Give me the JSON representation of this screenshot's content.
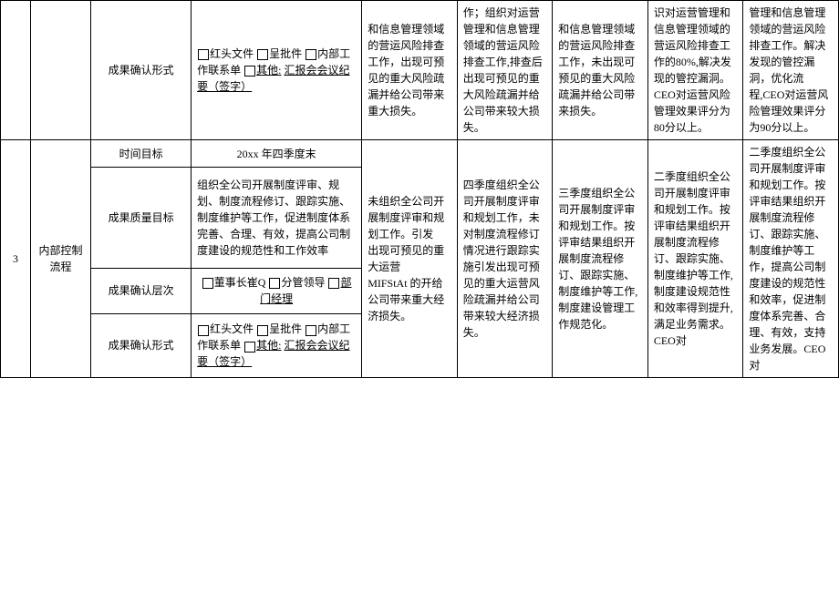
{
  "row1": {
    "label": "成果确认形式",
    "option1_pre": "红头文件",
    "option2_pre": "呈批件",
    "option3_pre": "内部工作联系单",
    "option4_pre": "其他:",
    "other_text": "汇报会会议纪要（签字）",
    "c5": "和信息管理领域的营运风险排查工作，出现可预见的重大风险疏漏并给公司带来重大损失。",
    "c6": "作；组织对运营管理和信息管理领域的营运风险排查工作,排查后出现可预见的重大风险疏漏并给公司带来较大损失。",
    "c7": "和信息管理领域的营运风险排查工作，未出现可预见的重大风险疏漏并给公司带来损失。",
    "c8": "识对运营管理和信息管理领域的营运风险排查工作的80%,解决发现的管控漏洞。CEO对运营风险管理效果评分为80分以上。",
    "c9": "管理和信息管理领域的营运风险排查工作。解决发现的管控漏洞，优化流程,CEO对运营风险管理效果评分为90分以上。"
  },
  "row2": {
    "num": "3",
    "category": "内部控制流程",
    "time_label": "时间目标",
    "time_value": "20xx 年四季度末",
    "quality_label": "成果质量目标",
    "quality_value": "组织全公司开展制度评审、规划、制度流程修订、跟踪实施、制度维护等工作，促进制度体系完善、合理、有效，提高公司制度建设的规范性和工作效率",
    "level_label": "成果确认层次",
    "level_opt1": "董事长崔Q",
    "level_opt2": "分管领导",
    "level_opt3": "部门经理",
    "form_label": "成果确认形式",
    "form_opt1": "红头文件",
    "form_opt2": "呈批件",
    "form_opt3": "内部工作联系单",
    "form_opt4": "其他:",
    "form_other": "汇报会会议纪要（签字）",
    "c5_a": "未组织全公司开展制度评审和规划工作。引发",
    "c5_b": "出现可预见的重大运营",
    "c5_c": "MIFStAt 的开给公司带来重大经济损失。",
    "c6": "四季度组织全公司开展制度评审和规划工作，未对制度流程修订情况进行跟踪实施引发出现可预见的重大运营风险疏漏并给公司带来较大经济损失。",
    "c7": "三季度组织全公司开展制度评审和规划工作。按评审结果组织开展制度流程修订、跟踪实施、制度维护等工作,制度建设管理工作规范化。",
    "c8": "二季度组织全公司开展制度评审和规划工作。按评审结果组织开展制度流程修订、跟踪实施、制度维护等工作,制度建设规范性和效率得到提升,满足业务需求。CEO对",
    "c9": "二季度组织全公司开展制度评审和规划工作。按评审结果组织开展制度流程修订、跟踪实施、制度维护等工作，提高公司制度建设的规范性和效率，促进制度体系完善、合理、有效，支持业务发展。CEO对"
  }
}
